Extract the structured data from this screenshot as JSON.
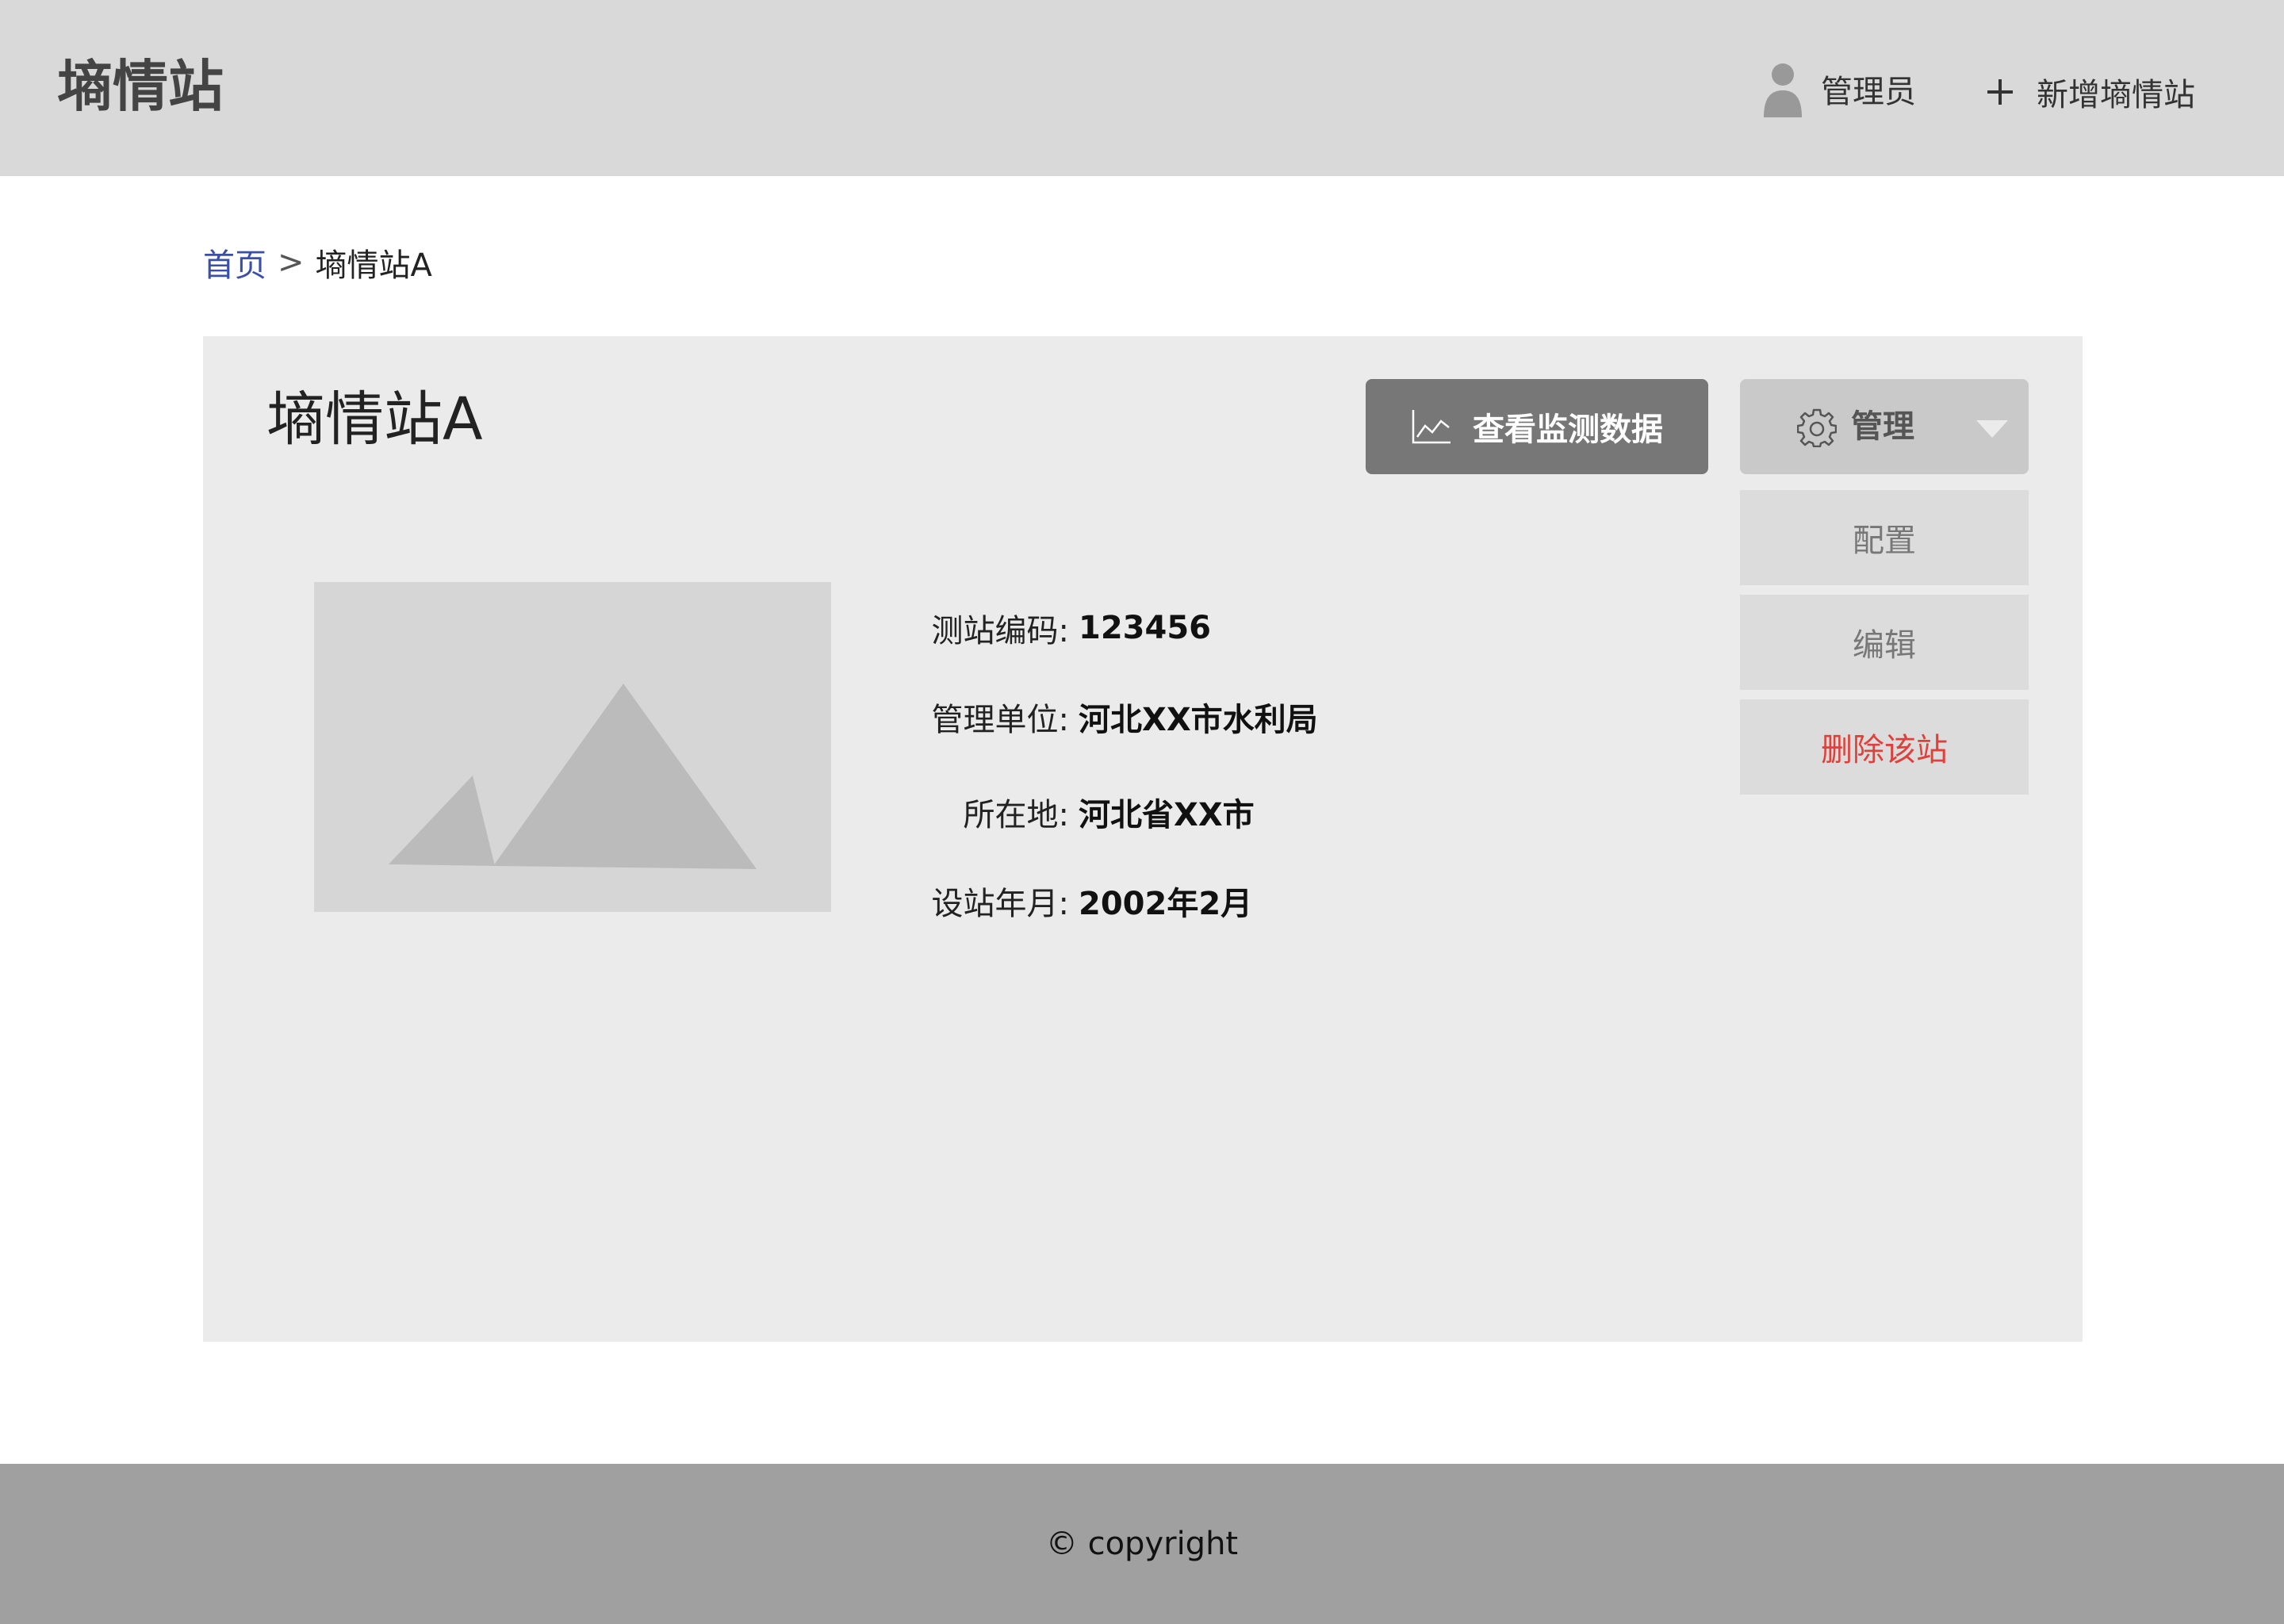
{
  "header": {
    "app_title": "墒情站",
    "user_name": "管理员",
    "add_station_label": "新增墒情站"
  },
  "breadcrumb": {
    "home": "首页",
    "separator": ">",
    "current": "墒情站A"
  },
  "station": {
    "title": "墒情站A",
    "image_icon": "image-placeholder-icon",
    "info": [
      {
        "label": "测站编码:",
        "value": "123456"
      },
      {
        "label": "管理单位:",
        "value": "河北XX市水利局"
      },
      {
        "label": "所在地:",
        "value": "河北省XX市"
      },
      {
        "label": "设站年月:",
        "value": "2002年2月"
      }
    ]
  },
  "actions": {
    "monitor_label": "查看监测数据",
    "monitor_icon": "line-chart-icon",
    "manage_label": "管理",
    "manage_icon": "gear-icon",
    "menu": [
      {
        "label": "配置"
      },
      {
        "label": "编辑"
      },
      {
        "label": "删除该站"
      }
    ]
  },
  "footer": {
    "copyright": "© copyright"
  },
  "colors": {
    "header_bg": "#d9d9d9",
    "card_bg": "#ebebeb",
    "primary_button": "#777777",
    "link": "#3a4fa8",
    "danger": "#e0403a",
    "footer_bg": "#a0a0a0"
  }
}
